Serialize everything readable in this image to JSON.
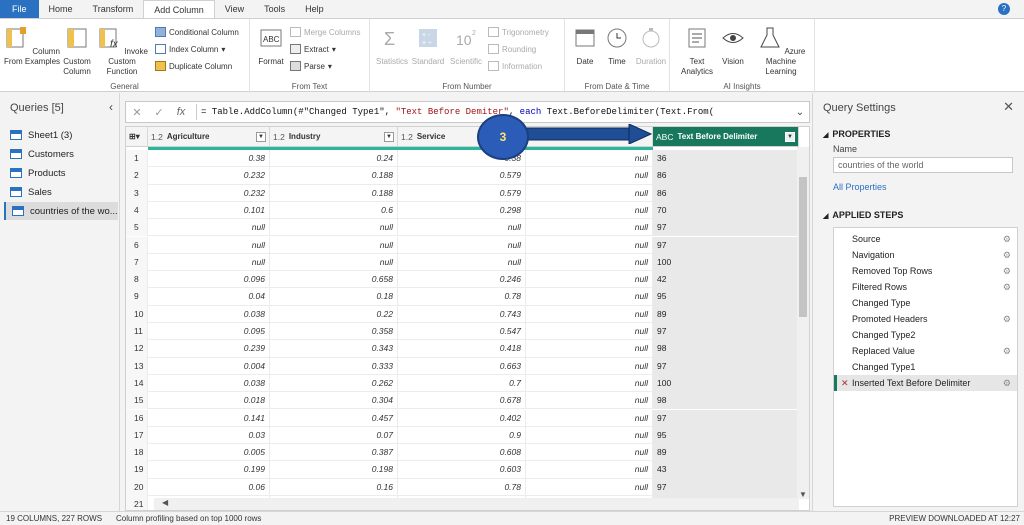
{
  "tabs": [
    "File",
    "Home",
    "Transform",
    "Add Column",
    "View",
    "Tools",
    "Help"
  ],
  "ribbon": {
    "general": {
      "label": "General",
      "column_from_examples": "Column From Examples",
      "custom_column": "Custom Column",
      "invoke_custom_function": "Invoke Custom Function",
      "conditional_column": "Conditional Column",
      "index_column": "Index Column",
      "duplicate_column": "Duplicate Column"
    },
    "from_text": {
      "label": "From Text",
      "format": "Format",
      "merge_columns": "Merge Columns",
      "extract": "Extract",
      "parse": "Parse"
    },
    "from_number": {
      "label": "From Number",
      "statistics": "Statistics",
      "standard": "Standard",
      "scientific": "Scientific",
      "trigonometry": "Trigonometry",
      "rounding": "Rounding",
      "information": "Information"
    },
    "from_date_time": {
      "label": "From Date & Time",
      "date": "Date",
      "time": "Time",
      "duration": "Duration"
    },
    "ai_insights": {
      "label": "AI Insights",
      "text_analytics": "Text Analytics",
      "vision": "Vision",
      "azure_ml": "Azure Machine Learning"
    }
  },
  "queries": {
    "title": "Queries [5]",
    "items": [
      "Sheet1 (3)",
      "Customers",
      "Products",
      "Sales",
      "countries of the wo..."
    ]
  },
  "formula": {
    "prefix": "= Table.AddColumn(#\"Changed Type1\", ",
    "str1": "\"Text Before De",
    "mid": "",
    "str2": "miter\"",
    "sep": ", ",
    "kw": "each",
    "rest": " Text.BeforeDelimiter(Text.From("
  },
  "grid": {
    "columns": [
      {
        "type": "1.2",
        "name": "Agriculture"
      },
      {
        "type": "1.2",
        "name": "Industry"
      },
      {
        "type": "1.2",
        "name": "Service"
      },
      {
        "type": "ABC",
        "name": "Co"
      },
      {
        "type": "ABC",
        "name": "Text Before Delimiter"
      }
    ],
    "rows": [
      [
        "1",
        "0.38",
        "0.24",
        "0.38",
        "null",
        "36"
      ],
      [
        "2",
        "0.232",
        "0.188",
        "0.579",
        "null",
        "86"
      ],
      [
        "3",
        "0.232",
        "0.188",
        "0.579",
        "null",
        "86"
      ],
      [
        "4",
        "0.101",
        "0.6",
        "0.298",
        "null",
        "70"
      ],
      [
        "5",
        "null",
        "null",
        "null",
        "null",
        "97"
      ],
      [
        "6",
        "null",
        "null",
        "null",
        "null",
        "97"
      ],
      [
        "7",
        "null",
        "null",
        "null",
        "null",
        "100"
      ],
      [
        "8",
        "0.096",
        "0.658",
        "0.246",
        "null",
        "42"
      ],
      [
        "9",
        "0.04",
        "0.18",
        "0.78",
        "null",
        "95"
      ],
      [
        "10",
        "0.038",
        "0.22",
        "0.743",
        "null",
        "89"
      ],
      [
        "11",
        "0.095",
        "0.358",
        "0.547",
        "null",
        "97"
      ],
      [
        "12",
        "0.239",
        "0.343",
        "0.418",
        "null",
        "98"
      ],
      [
        "13",
        "0.004",
        "0.333",
        "0.663",
        "null",
        "97"
      ],
      [
        "14",
        "0.038",
        "0.262",
        "0.7",
        "null",
        "100"
      ],
      [
        "15",
        "0.018",
        "0.304",
        "0.678",
        "null",
        "98"
      ],
      [
        "16",
        "0.141",
        "0.457",
        "0.402",
        "null",
        "97"
      ],
      [
        "17",
        "0.03",
        "0.07",
        "0.9",
        "null",
        "95"
      ],
      [
        "18",
        "0.005",
        "0.387",
        "0.608",
        "null",
        "89"
      ],
      [
        "19",
        "0.199",
        "0.198",
        "0.603",
        "null",
        "43"
      ],
      [
        "20",
        "0.06",
        "0.16",
        "0.78",
        "null",
        "97"
      ],
      [
        "21",
        "0.093",
        "0.316",
        "0.591",
        "null",
        "99"
      ]
    ]
  },
  "annotation": {
    "number": "3"
  },
  "settings": {
    "title": "Query Settings",
    "properties_title": "PROPERTIES",
    "name_label": "Name",
    "name_value": "countries of the world",
    "all_properties": "All Properties",
    "applied_steps_title": "APPLIED STEPS",
    "steps": [
      {
        "name": "Source",
        "gear": true
      },
      {
        "name": "Navigation",
        "gear": true
      },
      {
        "name": "Removed Top Rows",
        "gear": true
      },
      {
        "name": "Filtered Rows",
        "gear": true
      },
      {
        "name": "Changed Type",
        "gear": false
      },
      {
        "name": "Promoted Headers",
        "gear": true
      },
      {
        "name": "Changed Type2",
        "gear": false
      },
      {
        "name": "Replaced Value",
        "gear": true
      },
      {
        "name": "Changed Type1",
        "gear": false
      },
      {
        "name": "Inserted Text Before Delimiter",
        "gear": true
      }
    ]
  },
  "status": {
    "columns_rows": "19 COLUMNS, 227 ROWS",
    "profiling": "Column profiling based on top 1000 rows",
    "preview": "PREVIEW DOWNLOADED AT 12:27"
  },
  "colors": {
    "accent": "#2b71c2",
    "selected_column": "#17785d",
    "quality_bar": "#2bb59a"
  }
}
